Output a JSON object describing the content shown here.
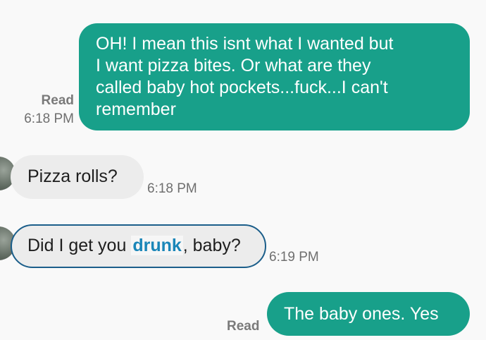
{
  "messages": [
    {
      "direction": "outgoing",
      "lines": [
        "OH! I mean this isnt what I wanted but",
        "I  want pizza bites. Or what are they",
        "called baby hot pockets...fuck...I can't",
        "remember"
      ],
      "status": "Read",
      "time": "6:18 PM"
    },
    {
      "direction": "incoming",
      "text": "Pizza rolls?",
      "time": "6:18 PM"
    },
    {
      "direction": "incoming",
      "text_before": "Did I get you ",
      "text_highlight": "drunk",
      "text_after": ", baby?",
      "time": "6:19 PM",
      "selected": true
    },
    {
      "direction": "outgoing",
      "text": "The baby ones. Yes",
      "status": "Read"
    }
  ],
  "colors": {
    "background": "#f9f9f9",
    "outgoing_bubble": "#18a08a",
    "incoming_bubble": "#ececec",
    "selection_border": "#1b5e8a",
    "highlight_text": "#1a86b8",
    "meta_text": "#6f6f6f"
  },
  "icons": {
    "avatar": "contact-avatar"
  }
}
